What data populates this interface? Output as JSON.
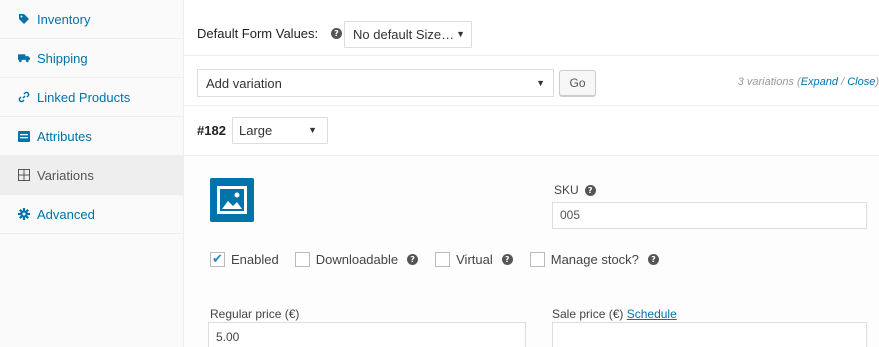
{
  "sidebar": {
    "items": [
      {
        "label": "Inventory",
        "icon": "inventory-icon"
      },
      {
        "label": "Shipping",
        "icon": "truck-icon"
      },
      {
        "label": "Linked Products",
        "icon": "link-icon"
      },
      {
        "label": "Attributes",
        "icon": "attributes-icon"
      },
      {
        "label": "Variations",
        "icon": "grid-icon"
      },
      {
        "label": "Advanced",
        "icon": "gear-icon"
      }
    ],
    "active": "Variations"
  },
  "defaults": {
    "label": "Default Form Values:",
    "select_value": "No default Size…"
  },
  "variations_bar": {
    "add_select_value": "Add variation",
    "go_label": "Go",
    "count_text": "3 variations",
    "expand_label": "Expand",
    "separator": " / ",
    "close_label": "Close"
  },
  "variation": {
    "id": "#182",
    "size": "Large",
    "sku_label": "SKU",
    "sku_value": "005",
    "enabled_label": "Enabled",
    "downloadable_label": "Downloadable",
    "virtual_label": "Virtual",
    "manage_stock_label": "Manage stock?",
    "enabled": true,
    "downloadable": false,
    "virtual": false,
    "manage_stock": false,
    "regular_price_label": "Regular price (€)",
    "regular_price_value": "5.00",
    "sale_price_label": "Sale price (€)",
    "schedule_label": "Schedule",
    "sale_price_value": ""
  },
  "colors": {
    "link": "#0073aa",
    "accent": "#0073aa",
    "check": "#1e8cbe"
  }
}
